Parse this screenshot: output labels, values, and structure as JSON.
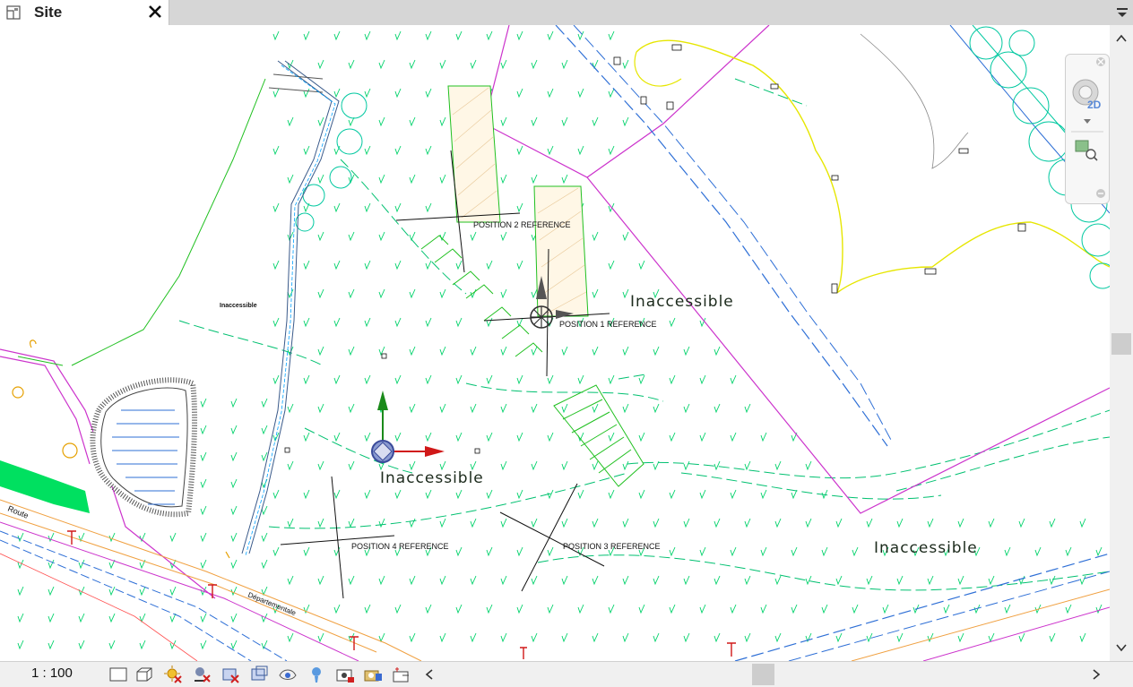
{
  "tab": {
    "title": "Site",
    "icon": "site-plan-icon",
    "close_icon": "close-icon",
    "menu_icon": "dropdown-menu-icon"
  },
  "canvas": {
    "labels": {
      "position_1": "POSITION 1 REFERENCE",
      "position_2": "POSITION 2 REFERENCE",
      "position_3": "POSITION 3 REFERENCE",
      "position_4": "POSITION 4 REFERENCE",
      "inaccessible_center": "Inaccessible",
      "inaccessible_lower": "Inaccessible",
      "inaccessible_right": "Inaccessible",
      "small_inaccessible": "Inaccessible",
      "route": "Route",
      "road_name": "Départementale"
    },
    "colors": {
      "grass": "#00d26a",
      "boundary": "#cc33cc",
      "contour": "#e6e600",
      "tree": "#00c8a0",
      "water": "#2e6fd6",
      "road": "#f0a040",
      "axis_y": "#1a8a1a",
      "axis_x": "#d01818"
    }
  },
  "navigation_bar": {
    "mode_label": "2D",
    "icons": [
      "close-small-icon",
      "steering-wheel-icon",
      "chevron-down-icon",
      "zoom-region-icon",
      "minus-icon"
    ]
  },
  "statusbar": {
    "scale": "1 : 100",
    "icons": [
      "detail-level-icon",
      "visual-style-icon",
      "sun-path-icon",
      "shadows-icon",
      "crop-view-icon",
      "show-crop-region-icon",
      "temporary-hide-icon",
      "reveal-hidden-icon",
      "temporary-view-properties-icon",
      "camera-icon",
      "highlight-displacement-icon",
      "reveal-constraints-icon"
    ]
  }
}
